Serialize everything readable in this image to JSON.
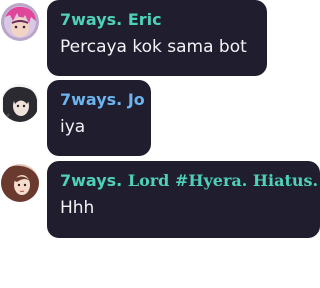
{
  "colors": {
    "bubble_bg": "#1f1d2e",
    "message_text": "#f3f3f6",
    "name_teal": "#4fd1b8",
    "name_blue": "#6cb4ee"
  },
  "messages": [
    {
      "avatar_icon": "user-avatar-icon",
      "author": "7ways. Eric",
      "text": "Percaya kok sama bot"
    },
    {
      "avatar_icon": "user-avatar-icon",
      "author": "7ways. Jo",
      "text": "iya"
    },
    {
      "avatar_icon": "user-avatar-icon",
      "author_prefix": "7ways. ",
      "author_suffix": "Lord #Hyera. Hiatus.",
      "text": "Hhh"
    }
  ]
}
